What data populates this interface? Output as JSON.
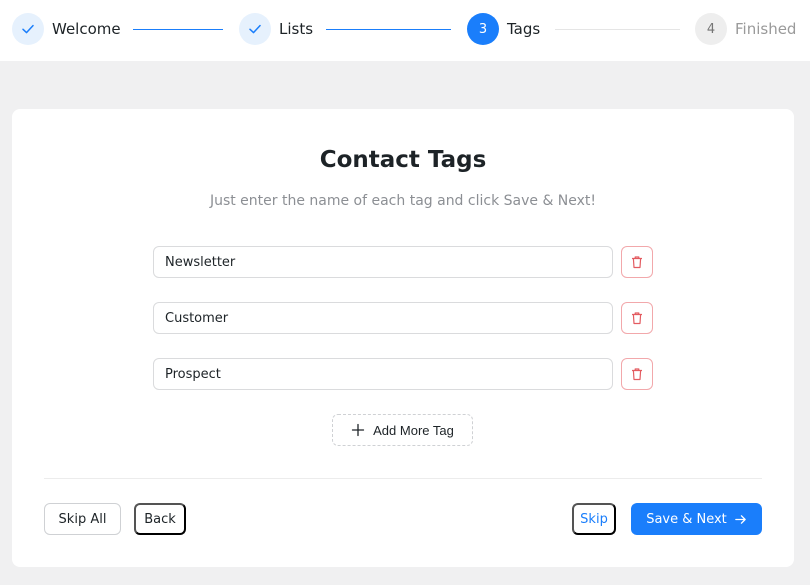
{
  "stepper": {
    "steps": [
      {
        "label": "Welcome",
        "state": "done",
        "number": ""
      },
      {
        "label": "Lists",
        "state": "done",
        "number": ""
      },
      {
        "label": "Tags",
        "state": "active",
        "number": "3"
      },
      {
        "label": "Finished",
        "state": "pending",
        "number": "4"
      }
    ]
  },
  "card": {
    "title": "Contact Tags",
    "subtitle": "Just enter the name of each tag and click Save & Next!",
    "tags": [
      "Newsletter",
      "Customer",
      "Prospect"
    ],
    "add_label": "Add More Tag"
  },
  "footer": {
    "skip_all_label": "Skip All",
    "back_label": "Back",
    "skip_label": "Skip",
    "save_next_label": "Save & Next"
  },
  "colors": {
    "accent": "#1a7efb",
    "danger": "#e35b60",
    "background": "#f0f0f1"
  },
  "icons": {
    "done_step": "check-icon",
    "remove_tag": "trash-icon",
    "add_tag": "plus-icon",
    "next": "arrow-right-icon"
  }
}
